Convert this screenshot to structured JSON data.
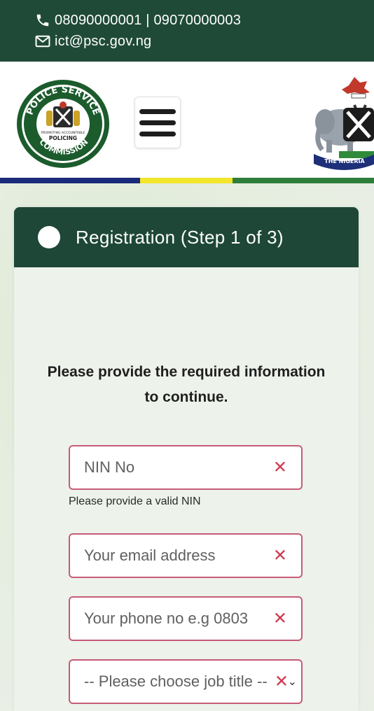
{
  "contact": {
    "phones": "08090000001 | 09070000003",
    "email": "ict@psc.gov.ng"
  },
  "header": {
    "logo_text_top": "POLICE SERVICE",
    "logo_text_bottom": "COMMISSION",
    "logo_center_text": "PROMOTING ACCOUNTABLE",
    "logo_center_text2": "POLICING",
    "crest_text": "THE NIGERIA"
  },
  "colors": {
    "topbar": "#1f4a38",
    "card_header": "#1e4737",
    "field_border": "#c75b78",
    "error_icon": "#d0384e",
    "stripe": [
      "#1b2a7a",
      "#f2e52b",
      "#2f7d3a"
    ]
  },
  "registration": {
    "title": "Registration (Step 1 of 3)",
    "instruction": "Please provide the required information to continue.",
    "fields": [
      {
        "placeholder": "NIN No",
        "hint": "Please provide a valid NIN"
      },
      {
        "placeholder": "Your email address"
      },
      {
        "placeholder": "Your phone no e.g 0803"
      },
      {
        "placeholder": "-- Please choose job title --"
      }
    ]
  },
  "icons": [
    "phone-icon",
    "envelope-icon",
    "menu-icon",
    "error-x-icon",
    "chevron-down-icon"
  ]
}
